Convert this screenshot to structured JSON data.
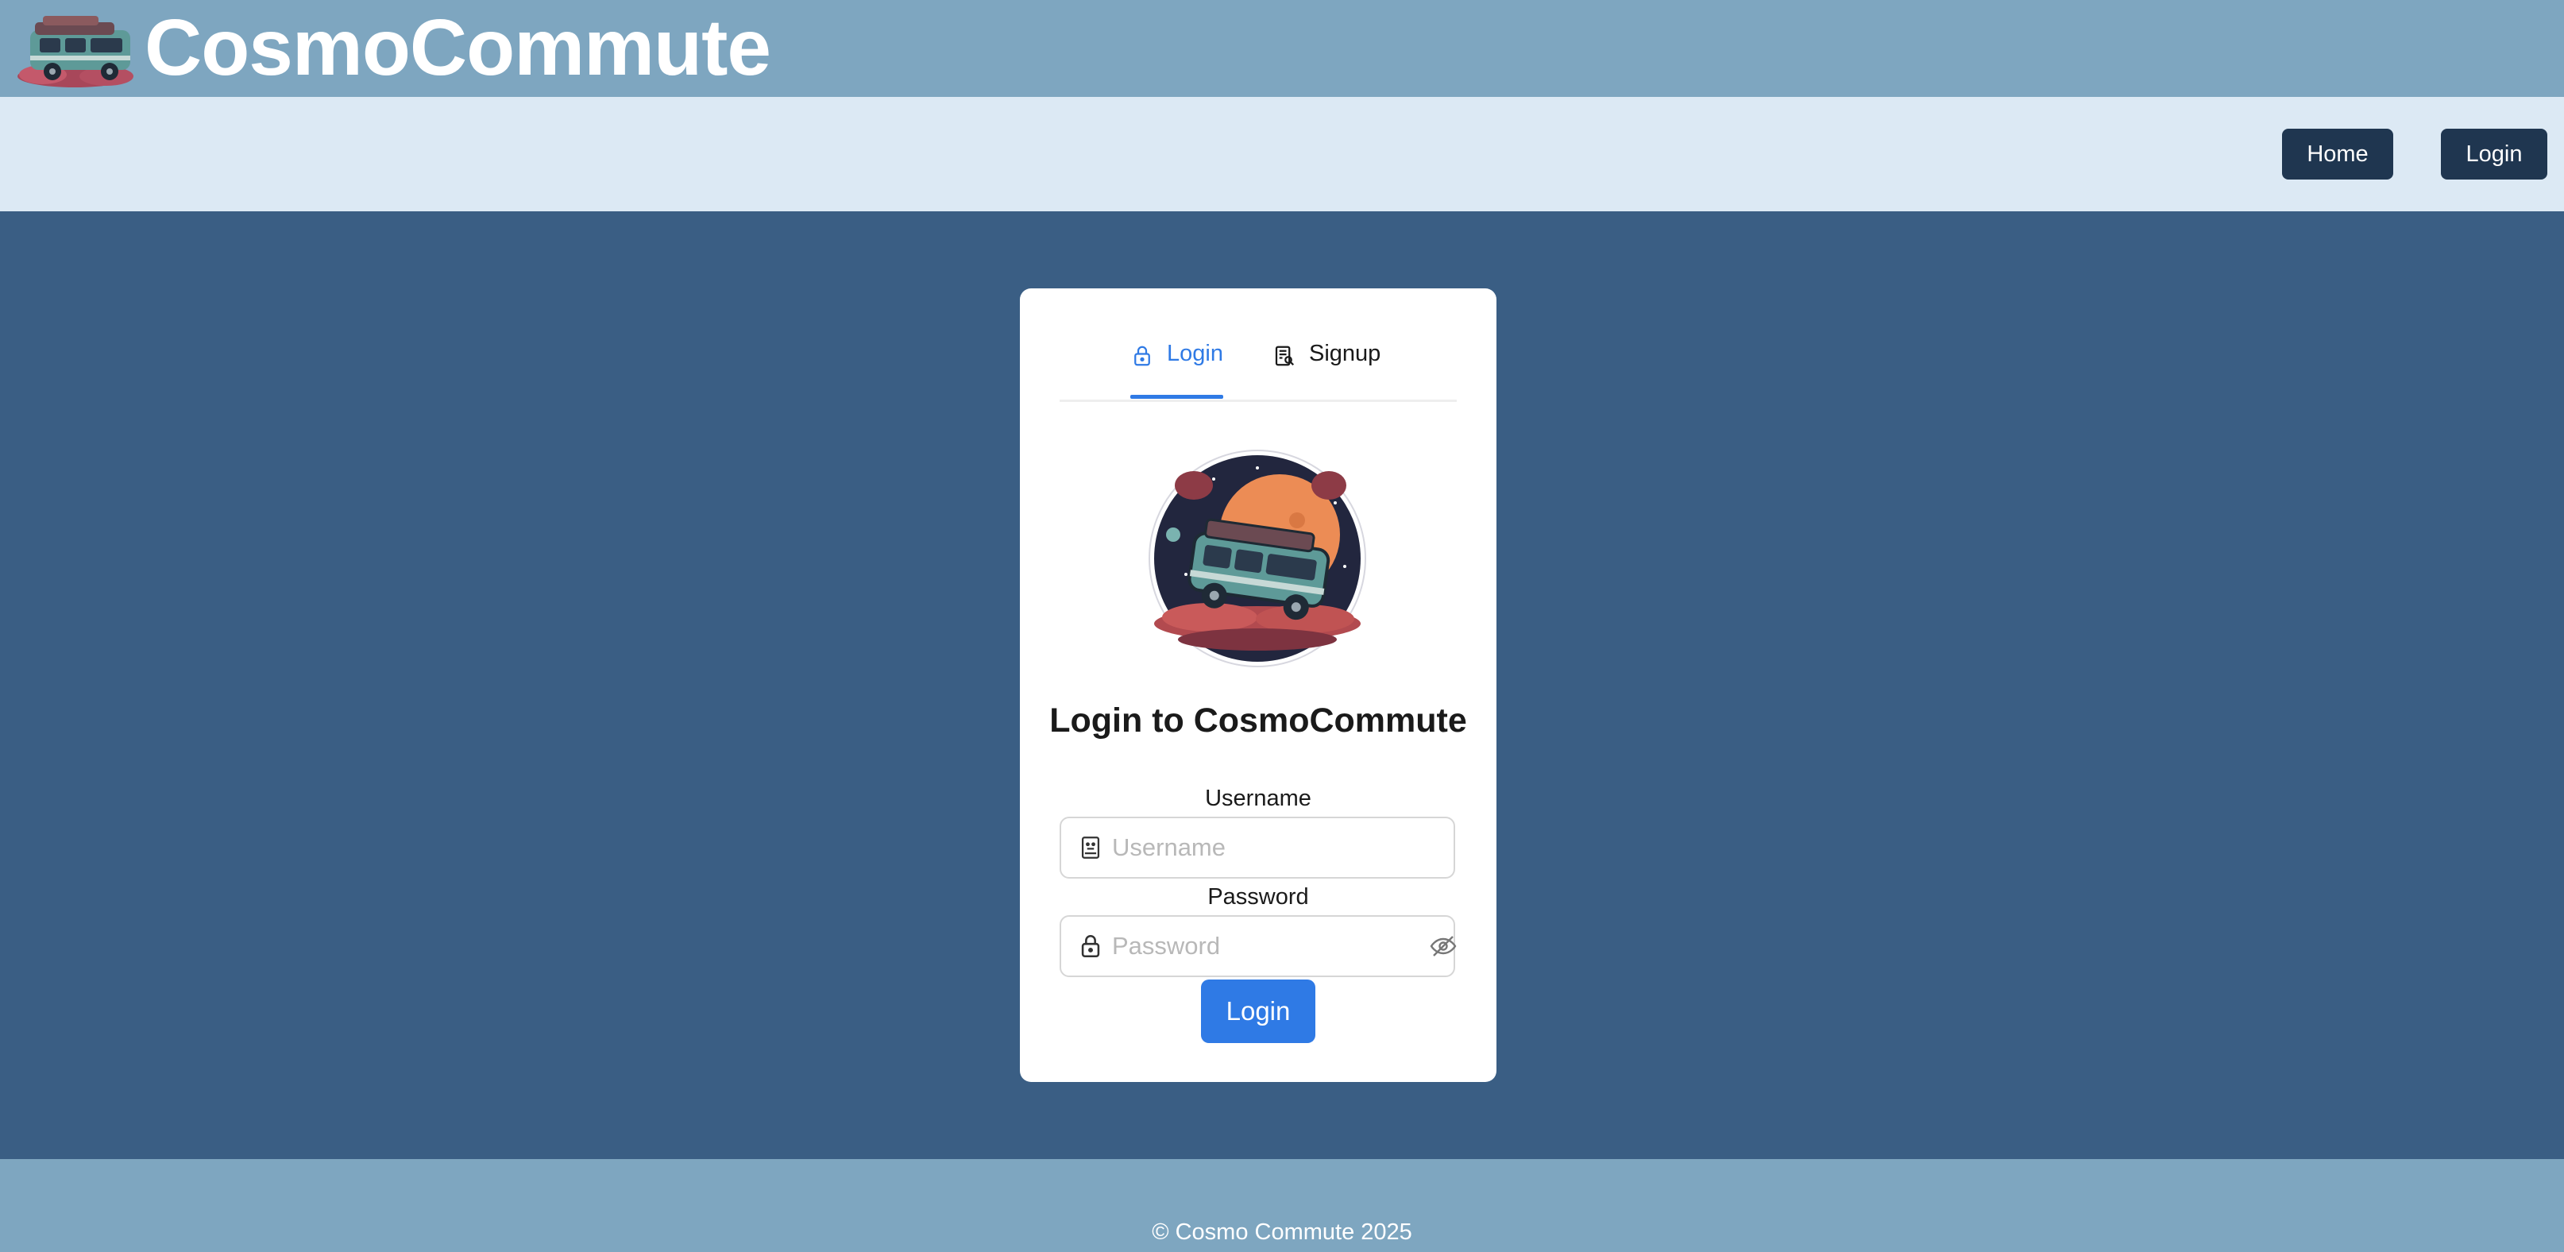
{
  "brand": {
    "title": "CosmoCommute",
    "logo_icon": "space-van-logo"
  },
  "nav": {
    "home_label": "Home",
    "login_label": "Login"
  },
  "tabs": [
    {
      "label": "Login",
      "icon": "lock-icon",
      "active": true
    },
    {
      "label": "Signup",
      "icon": "form-icon",
      "active": false
    }
  ],
  "card": {
    "hero_icon": "space-van-moon-illustration",
    "heading": "Login to CosmoCommute",
    "username_label": "Username",
    "username_placeholder": "Username",
    "username_value": "",
    "password_label": "Password",
    "password_placeholder": "Password",
    "password_value": "",
    "submit_label": "Login"
  },
  "footer": {
    "text": "© Cosmo Commute 2025"
  },
  "colors": {
    "brand_bar": "#7ea6c0",
    "nav_bar": "#dce9f4",
    "page_bg": "#3a5e84",
    "nav_button": "#1f3650",
    "accent": "#2f7ae5"
  }
}
